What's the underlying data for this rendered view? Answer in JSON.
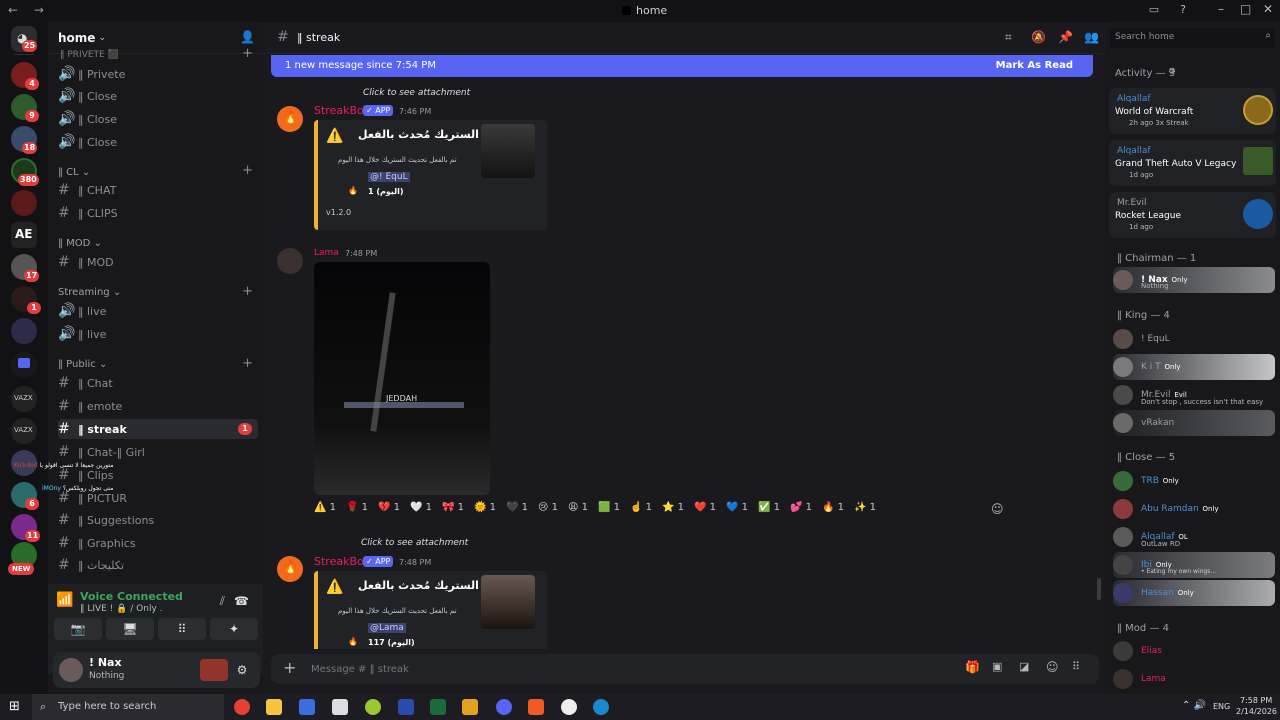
{
  "window": {
    "title": "home",
    "nav": "← →"
  },
  "server_badges": [
    "25",
    "4",
    "9",
    "18",
    "380",
    "17",
    "1",
    "6",
    "11"
  ],
  "sidebar": {
    "server_name": "home",
    "channels": [
      {
        "cat": "",
        "name": "‖ Privete",
        "voice": true
      },
      {
        "name": "‖ Close",
        "voice": true
      },
      {
        "name": "‖ Close",
        "voice": true
      },
      {
        "name": "‖ Close",
        "voice": true
      },
      {
        "cat_label": "‖ CL"
      },
      {
        "name": "‖ CHAT"
      },
      {
        "name": "‖ CLIPS"
      },
      {
        "cat_label": "‖ MOD"
      },
      {
        "name": "‖ MOD"
      },
      {
        "cat_label": "Streaming"
      },
      {
        "name": "‖ live",
        "voice": true
      },
      {
        "name": "‖ live",
        "voice": true
      },
      {
        "cat_label": "‖ Public"
      },
      {
        "name": "‖ Chat"
      },
      {
        "name": "‖ emote"
      },
      {
        "name": "‖ streak",
        "active": true
      },
      {
        "name": "‖ Chat-‖ Girl"
      },
      {
        "name": "‖ Clips"
      },
      {
        "name": "‖ PICTUR"
      },
      {
        "name": "‖ Suggestions"
      },
      {
        "name": "‖ Graphics"
      },
      {
        "name": "‖ تكليجات"
      }
    ],
    "streak_badge": "1",
    "voice": {
      "status": "Voice Connected",
      "channel": "‖ LIVE ! 🔒 / Only ."
    },
    "user": {
      "name": "! Nax",
      "status": "Nothing"
    },
    "voice_users": [
      {
        "name": "Kickdod",
        "note": "متورين جميعا لا تنسى اقولو يا"
      },
      {
        "name": "iMOny",
        "note": "متى تجول روبلكس؟"
      }
    ],
    "new_badge": "NEW"
  },
  "main": {
    "channel": "‖ streak",
    "banner": {
      "text": "1 new message since 7:54 PM",
      "action": "Mark As Read"
    },
    "msg1": {
      "reply": "Click to see attachment",
      "author": "StreakBot",
      "app": "✓ APP",
      "time": "7:46 PM",
      "title": "الستريك مُحدث بالفعل",
      "body": "تم بالفعل تحديث الستريك خلال هذا اليوم",
      "mention": "@! EquL",
      "count": "1 (اليوم)",
      "footer": "v1.2.0"
    },
    "msg2": {
      "author": "Lama",
      "time": "7:48 PM",
      "image_text": "JEDDAH"
    },
    "reactions": [
      "⚠️ 1",
      "🌹 1",
      "💔 1",
      "🤍 1",
      "🎀 1",
      "🌞 1",
      "🖤 1",
      "😢 1",
      "😩 1",
      "🟩 1",
      "☝️ 1",
      "⭐ 1",
      "❤️ 1",
      "💙 1",
      "✅ 1",
      "💕 1",
      "🔥 1",
      "✨ 1"
    ],
    "msg3": {
      "reply": "Click to see attachment",
      "author": "StreakBot",
      "app": "✓ APP",
      "time": "7:48 PM",
      "title": "الستريك مُحدث بالفعل",
      "body": "تم بالفعل تحديث الستريك خلال هذا اليوم",
      "mention": "@Lama",
      "count": "117 (اليوم)"
    },
    "composer_placeholder": "Message # ‖ streak"
  },
  "right": {
    "search_placeholder": "Search home",
    "activity": "Activity — 3",
    "activities": [
      {
        "user": "Alqallaf",
        "game": "World of Warcraft",
        "meta": "2h ago   3x Streak"
      },
      {
        "user": "Alqallaf",
        "game": "Grand Theft Auto V Legacy",
        "meta": "1d ago"
      },
      {
        "user": "Mr.Evil",
        "game": "Rocket League",
        "meta": "1d ago"
      }
    ],
    "groups": [
      {
        "label": "‖ Chairman — 1",
        "members": [
          {
            "name": "! Nax",
            "tag": "Only",
            "status": "Nothing"
          }
        ]
      },
      {
        "label": "‖ King — 4",
        "members": [
          {
            "name": "! EquL",
            "tag": "",
            "status": ""
          },
          {
            "name": "K i T",
            "tag": "Only",
            "status": ""
          },
          {
            "name": "Mr.Evil",
            "tag": "Evil",
            "status": "Don't stop , success isn't that easy"
          },
          {
            "name": "vRakan",
            "tag": "",
            "status": ""
          }
        ]
      },
      {
        "label": "‖ Close — 5",
        "members": [
          {
            "name": "TRB",
            "tag": "Only",
            "status": ""
          },
          {
            "name": "Abu Ramdan",
            "tag": "Only",
            "status": ""
          },
          {
            "name": "Alqallaf",
            "tag": "OL",
            "status": "OutLaw RD"
          },
          {
            "name": "Ibi",
            "tag": "Only",
            "status": "• Eating my own wings..."
          },
          {
            "name": "Hassan",
            "tag": "Only",
            "status": ""
          }
        ]
      },
      {
        "label": "‖ Mod — 4",
        "members": [
          {
            "name": "Elias",
            "tag": "",
            "status": ""
          },
          {
            "name": "Lama",
            "tag": "",
            "status": ""
          }
        ]
      }
    ]
  },
  "taskbar": {
    "search": "Type here to search",
    "lang": "ENG",
    "time": "7:58 PM",
    "date": "2/14/2026"
  }
}
